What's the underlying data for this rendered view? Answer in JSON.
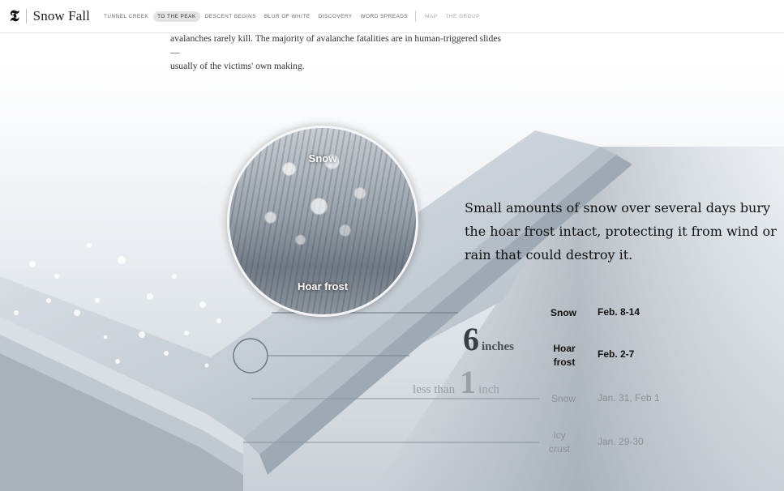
{
  "header": {
    "logo": "𝕿",
    "brand": "Snow Fall",
    "nav_items": [
      "TUNNEL CREEK",
      "TO THE PEAK",
      "DESCENT BEGINS",
      "BLUR OF WHITE",
      "DISCOVERY",
      "WORD SPREADS"
    ],
    "nav_extra": [
      "MAP",
      "THE GROUP"
    ],
    "active_item": "TO THE PEAK"
  },
  "intro": {
    "line1": "avalanches rarely kill. The majority of avalanche fatalities are in human-triggered slides —",
    "line2": "usually of the victims' own making."
  },
  "graphic": {
    "circle_top_label": "Snow",
    "circle_bottom_label": "Hoar frost",
    "caption": "Small amounts of snow over several days bury the hoar frost intact, protecting it from wind or rain that could destroy it.",
    "depth_six": {
      "num": "6",
      "unit": "inches"
    },
    "depth_one": {
      "prefix": "less than",
      "num": "1",
      "unit": "inch"
    },
    "layers": [
      {
        "label": "Snow",
        "date": "Feb. 8-14",
        "emphasis": "dark"
      },
      {
        "label": "Hoar frost",
        "date": "Feb. 2-7",
        "emphasis": "dark"
      },
      {
        "label": "Snow",
        "date": "Jan. 31, Feb 1",
        "emphasis": "dim"
      },
      {
        "label": "Icy crust",
        "date": "Jan. 29-30",
        "emphasis": "dim"
      }
    ]
  }
}
